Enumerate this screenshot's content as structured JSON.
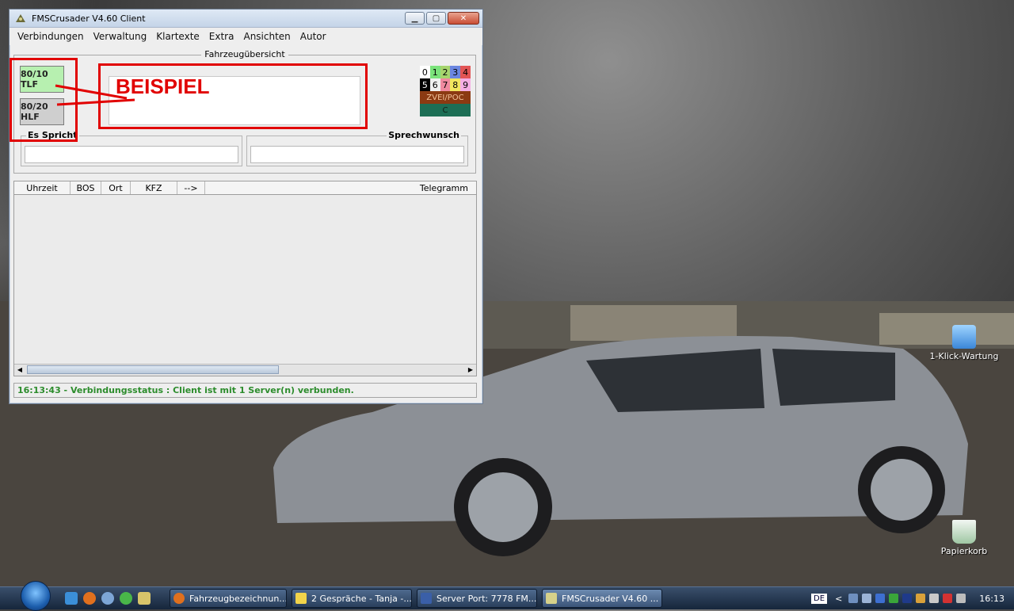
{
  "window": {
    "title": "FMSCrusader V4.60 Client",
    "minimize": "▁",
    "maximize": "▢",
    "close": "✕"
  },
  "menu": [
    "Verbindungen",
    "Verwaltung",
    "Klartexte",
    "Extra",
    "Ansichten",
    "Autor"
  ],
  "overview": {
    "title": "Fahrzeugübersicht",
    "vehicles": [
      "80/10 TLF",
      "80/20 HLF"
    ],
    "annotation": "BEISPIEL"
  },
  "status_codes": {
    "row1": [
      "0",
      "1",
      "2",
      "3",
      "4"
    ],
    "row2": [
      "5",
      "6",
      "7",
      "8",
      "9"
    ],
    "zvei": "ZVEI/POC",
    "c": "C",
    "colors": {
      "0": "#ffffff",
      "1": "#7be37b",
      "2": "#a6d46d",
      "3": "#6b86e0",
      "4": "#e25555",
      "5": "#000000",
      "6": "#f0f0f0",
      "7": "#f08aa0",
      "8": "#f2e65e",
      "9": "#f5aee4",
      "zvei": "#8b3a12",
      "c": "#1d6e55"
    }
  },
  "es_spricht": {
    "label": "Es Spricht"
  },
  "sprechwunsch": {
    "label": "Sprechwunsch"
  },
  "table": {
    "columns": [
      "Uhrzeit",
      "BOS",
      "Ort",
      "KFZ",
      "-->",
      "Telegramm"
    ]
  },
  "status_bar": "16:13:43 - Verbindungsstatus : Client ist mit 1 Server(n) verbunden.",
  "desktop_icons": [
    {
      "label": "1-Klick-Wartung"
    },
    {
      "label": "Papierkorb"
    }
  ],
  "taskbar": {
    "tasks": [
      "Fahrzeugbezeichnun...",
      "2 Gespräche - Tanja -...",
      "Server Port: 7778 FM...",
      "FMSCrusader V4.60 ..."
    ],
    "language": "DE",
    "arrow": "<",
    "clock": "16:13"
  }
}
